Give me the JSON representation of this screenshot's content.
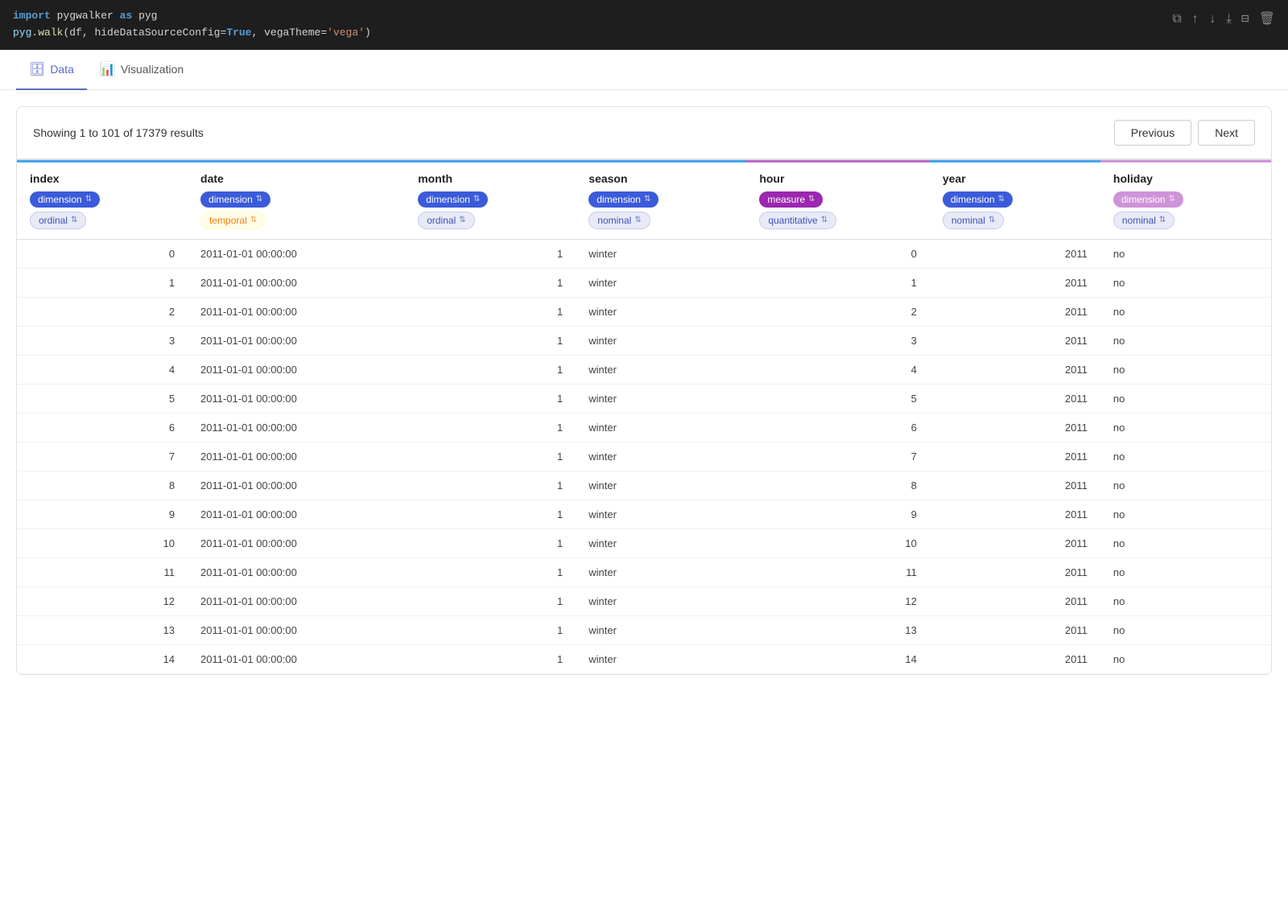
{
  "code": {
    "line1_import": "import",
    "line1_module": "pygwalker",
    "line1_as": "as",
    "line1_alias": "pyg",
    "line2_alias": "pyg",
    "line2_method": "walk",
    "line2_arg1": "df",
    "line2_param1": "hideDataSourceConfig",
    "line2_val1": "True",
    "line2_param2": "vegaTheme",
    "line2_val2": "'vega'"
  },
  "tabs": [
    {
      "id": "data",
      "label": "Data",
      "icon": "🗄",
      "active": true
    },
    {
      "id": "visualization",
      "label": "Visualization",
      "icon": "📊",
      "active": false
    }
  ],
  "toolbar": {
    "results_text": "Showing 1 to 101 of 17379 results",
    "prev_label": "Previous",
    "next_label": "Next"
  },
  "columns": [
    {
      "id": "index",
      "name": "index",
      "badge1_label": "dimension",
      "badge1_type": "blue",
      "badge2_label": "ordinal",
      "badge2_type": "ordinal",
      "top_color": "#42a5f5"
    },
    {
      "id": "date",
      "name": "date",
      "badge1_label": "dimension",
      "badge1_type": "blue",
      "badge2_label": "temporal",
      "badge2_type": "temporal",
      "top_color": "#42a5f5"
    },
    {
      "id": "month",
      "name": "month",
      "badge1_label": "dimension",
      "badge1_type": "blue",
      "badge2_label": "ordinal",
      "badge2_type": "ordinal",
      "top_color": "#42a5f5"
    },
    {
      "id": "season",
      "name": "season",
      "badge1_label": "dimension",
      "badge1_type": "blue",
      "badge2_label": "nominal",
      "badge2_type": "nominal",
      "top_color": "#42a5f5"
    },
    {
      "id": "hour",
      "name": "hour",
      "badge1_label": "measure",
      "badge1_type": "purple",
      "badge2_label": "quantitative",
      "badge2_type": "quantitative",
      "top_color": "#ba68c8"
    },
    {
      "id": "year",
      "name": "year",
      "badge1_label": "dimension",
      "badge1_type": "blue",
      "badge2_label": "nominal",
      "badge2_type": "nominal",
      "top_color": "#42a5f5"
    },
    {
      "id": "holiday",
      "name": "holiday",
      "badge1_label": "dimension",
      "badge1_type": "holiday-purple",
      "badge2_label": "nominal",
      "badge2_type": "nominal",
      "top_color": "#ce93d8"
    }
  ],
  "rows": [
    {
      "index": "0",
      "date": "2011-01-01 00:00:00",
      "month": "1",
      "season": "winter",
      "hour": "0",
      "year": "2011",
      "holiday": "no"
    },
    {
      "index": "1",
      "date": "2011-01-01 00:00:00",
      "month": "1",
      "season": "winter",
      "hour": "1",
      "year": "2011",
      "holiday": "no"
    },
    {
      "index": "2",
      "date": "2011-01-01 00:00:00",
      "month": "1",
      "season": "winter",
      "hour": "2",
      "year": "2011",
      "holiday": "no"
    },
    {
      "index": "3",
      "date": "2011-01-01 00:00:00",
      "month": "1",
      "season": "winter",
      "hour": "3",
      "year": "2011",
      "holiday": "no"
    },
    {
      "index": "4",
      "date": "2011-01-01 00:00:00",
      "month": "1",
      "season": "winter",
      "hour": "4",
      "year": "2011",
      "holiday": "no"
    },
    {
      "index": "5",
      "date": "2011-01-01 00:00:00",
      "month": "1",
      "season": "winter",
      "hour": "5",
      "year": "2011",
      "holiday": "no"
    },
    {
      "index": "6",
      "date": "2011-01-01 00:00:00",
      "month": "1",
      "season": "winter",
      "hour": "6",
      "year": "2011",
      "holiday": "no"
    },
    {
      "index": "7",
      "date": "2011-01-01 00:00:00",
      "month": "1",
      "season": "winter",
      "hour": "7",
      "year": "2011",
      "holiday": "no"
    },
    {
      "index": "8",
      "date": "2011-01-01 00:00:00",
      "month": "1",
      "season": "winter",
      "hour": "8",
      "year": "2011",
      "holiday": "no"
    },
    {
      "index": "9",
      "date": "2011-01-01 00:00:00",
      "month": "1",
      "season": "winter",
      "hour": "9",
      "year": "2011",
      "holiday": "no"
    },
    {
      "index": "10",
      "date": "2011-01-01 00:00:00",
      "month": "1",
      "season": "winter",
      "hour": "10",
      "year": "2011",
      "holiday": "no"
    },
    {
      "index": "11",
      "date": "2011-01-01 00:00:00",
      "month": "1",
      "season": "winter",
      "hour": "11",
      "year": "2011",
      "holiday": "no"
    },
    {
      "index": "12",
      "date": "2011-01-01 00:00:00",
      "month": "1",
      "season": "winter",
      "hour": "12",
      "year": "2011",
      "holiday": "no"
    },
    {
      "index": "13",
      "date": "2011-01-01 00:00:00",
      "month": "1",
      "season": "winter",
      "hour": "13",
      "year": "2011",
      "holiday": "no"
    },
    {
      "index": "14",
      "date": "2011-01-01 00:00:00",
      "month": "1",
      "season": "winter",
      "hour": "14",
      "year": "2011",
      "holiday": "no"
    }
  ]
}
